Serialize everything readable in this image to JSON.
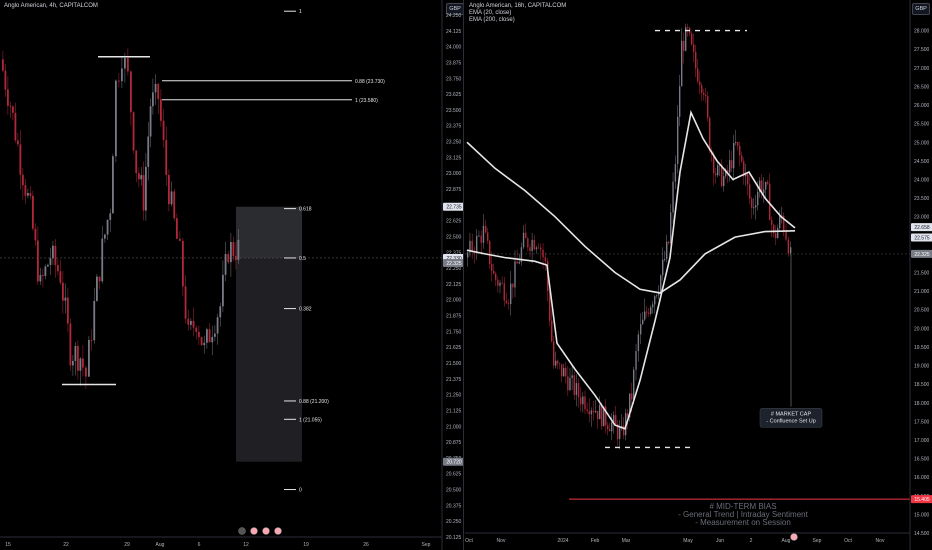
{
  "left": {
    "title": "Anglo American, 4h, CAPITALCOM",
    "currency": "GBP",
    "price_axis": {
      "min": 20.125,
      "max": 24.25,
      "step": 0.125,
      "labels": [
        "24.250",
        "24.125",
        "24.000",
        "23.875",
        "23.750",
        "23.625",
        "23.500",
        "23.375",
        "23.250",
        "23.125",
        "23.000",
        "22.875",
        "22.750",
        "22.625",
        "22.500",
        "22.375",
        "22.250",
        "22.125",
        "22.000",
        "21.875",
        "21.750",
        "21.625",
        "21.500",
        "21.375",
        "21.250",
        "21.125",
        "21.000",
        "20.875",
        "20.750",
        "20.625",
        "20.500",
        "20.375",
        "20.250",
        "20.125"
      ]
    },
    "time_axis": [
      "15",
      "22",
      "29",
      "Aug",
      "6",
      "12",
      "19",
      "26",
      "Sep"
    ],
    "badges": [
      {
        "text": "22.735",
        "value": 22.735,
        "color": "#e0e3eb",
        "textColor": "#131722"
      },
      {
        "text": "22.330",
        "value": 22.33,
        "color": "#e0e3eb",
        "textColor": "#131722"
      },
      {
        "text": "22.325",
        "value": 22.29,
        "color": "#787b86",
        "textColor": "#ffffff"
      },
      {
        "text": "20.720",
        "value": 20.72,
        "color": "#787b86",
        "textColor": "#ffffff"
      }
    ],
    "fib_levels": [
      {
        "label": "1",
        "value": 24.28
      },
      {
        "label": "0.88 (23.730)",
        "value": 23.73
      },
      {
        "label": "1 (23.580)",
        "value": 23.58
      },
      {
        "label": "0.618",
        "value": 22.72
      },
      {
        "label": "0.5",
        "value": 22.33
      },
      {
        "label": "0.382",
        "value": 21.93
      },
      {
        "label": "0.88 (21.200)",
        "value": 21.2
      },
      {
        "label": "1 (21.055)",
        "value": 21.055
      },
      {
        "label": "0",
        "value": 20.5
      }
    ],
    "box": {
      "top_value": 22.735,
      "mid_value": 22.33,
      "bottom_value": 20.72
    },
    "crosshair_value": 22.33,
    "bottom_icons": [
      "gear-icon",
      "flag-icon",
      "flag-icon",
      "flag-icon"
    ]
  },
  "right": {
    "title": "Anglo American, 16h, CAPITALCOM",
    "legend": [
      "EMA (20, close)",
      "EMA (200, close)"
    ],
    "currency": "GBP",
    "price_axis": {
      "min": 14.5,
      "max": 28.5,
      "step": 0.5,
      "labels": [
        "28.000",
        "27.500",
        "27.000",
        "26.500",
        "26.000",
        "25.500",
        "25.000",
        "24.500",
        "24.000",
        "23.500",
        "23.000",
        "22.500",
        "22.000",
        "21.500",
        "21.000",
        "20.500",
        "20.000",
        "19.500",
        "19.000",
        "18.500",
        "18.000",
        "17.500",
        "17.000",
        "16.500",
        "16.000",
        "15.500",
        "15.000",
        "14.500"
      ]
    },
    "time_axis": [
      "Oct",
      "Nov",
      "2024",
      "Feb",
      "Mar",
      "May",
      "Jun",
      "2",
      "Aug",
      "Sep",
      "Oct",
      "Nov"
    ],
    "badges": [
      {
        "text": "22.658",
        "value": 22.72,
        "color": "#e0e3eb",
        "textColor": "#131722"
      },
      {
        "text": "22.575",
        "value": 22.44,
        "color": "#e0e3eb",
        "textColor": "#131722"
      },
      {
        "text": "22.325",
        "value": 22.0,
        "color": "#787b86",
        "textColor": "#ffffff"
      },
      {
        "text": "15.405",
        "value": 15.41,
        "color": "#f23645",
        "textColor": "#ffffff"
      }
    ],
    "market_cap_label": [
      "# MARKET CAP",
      "- Confluence Set Up"
    ],
    "bias_text": [
      "# MID-TERM BIAS",
      "- General Trend  |  Intraday Sentiment",
      "- Measurement on Session"
    ],
    "red_line_value": 15.41,
    "crosshair_value": 22.0
  },
  "colors": {
    "background": "#000000",
    "up_candle": "#787b86",
    "down_candle": "#b2283a",
    "ema_line": "#e6e6e6",
    "axis_text": "#b2b5be",
    "bias_text": "#6a6d78",
    "red_line": "#f23645"
  }
}
